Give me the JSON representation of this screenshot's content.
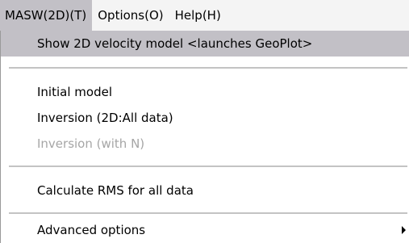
{
  "menubar": {
    "items": [
      {
        "label": "MASW(2D)(T)"
      },
      {
        "label": "Options(O)"
      },
      {
        "label": "Help(H)"
      }
    ]
  },
  "menu": {
    "items": [
      {
        "label": "Show 2D velocity model <launches GeoPlot>"
      },
      {
        "label": "Initial model"
      },
      {
        "label": "Inversion (2D:All data)"
      },
      {
        "label": "Inversion (with N)"
      },
      {
        "label": "Calculate RMS for all data"
      },
      {
        "label": "Advanced options"
      }
    ]
  },
  "icons": {
    "submenu": "chevron-right-icon"
  },
  "colors": {
    "highlight": "#c2c0c6",
    "disabled_text": "#a6a6a6",
    "separator": "#c3c3c3"
  }
}
